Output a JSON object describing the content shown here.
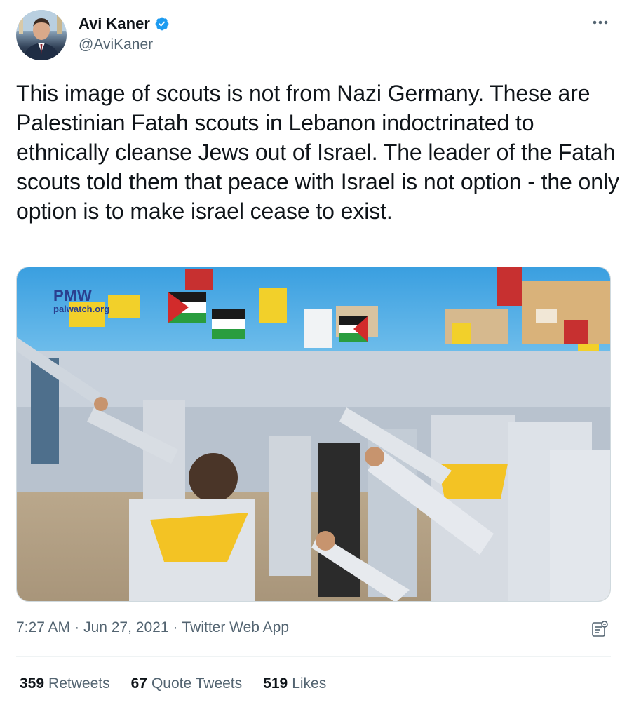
{
  "author": {
    "name": "Avi Kaner",
    "handle": "@AviKaner",
    "verified": true
  },
  "tweet": {
    "text": "This image of scouts is not from Nazi Germany. These are Palestinian Fatah scouts in Lebanon indoctrinated to ethnically cleanse Jews out of Israel. The leader of the Fatah scouts told them that peace with Israel is not option - the only option is to make israel cease to exist."
  },
  "media": {
    "watermark_title": "PMW",
    "watermark_site": "palwatch.org"
  },
  "meta": {
    "time": "7:27 AM",
    "separator": "·",
    "date": "Jun 27, 2021",
    "source": "Twitter Web App"
  },
  "stats": [
    {
      "count": "359",
      "label": "Retweets"
    },
    {
      "count": "67",
      "label": "Quote Tweets"
    },
    {
      "count": "519",
      "label": "Likes"
    }
  ],
  "colors": {
    "verified": "#1d9bf0",
    "text_primary": "#0f1419",
    "text_secondary": "#536471"
  },
  "icons": [
    "verified-badge-icon",
    "more-options-icon",
    "analytics-icon"
  ]
}
